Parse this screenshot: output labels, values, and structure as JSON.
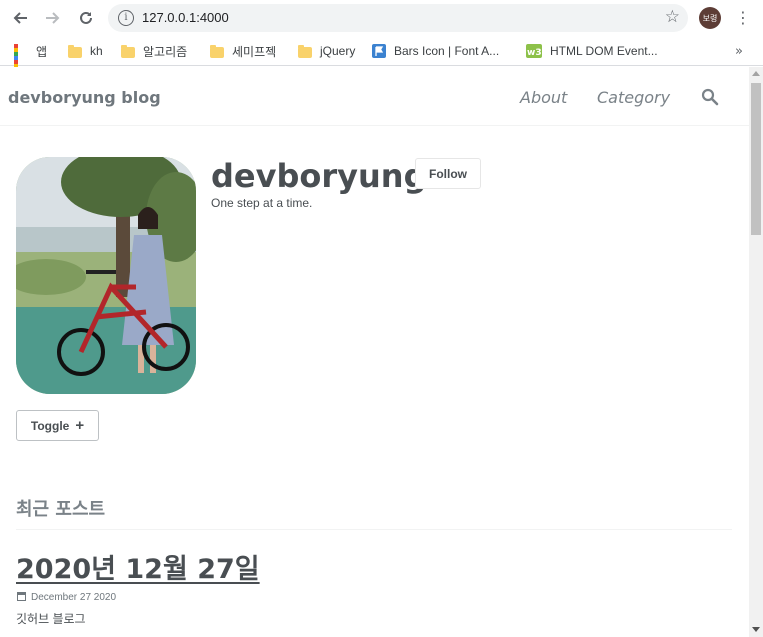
{
  "browser": {
    "url": "127.0.0.1:4000",
    "profile_label": "보령",
    "bookmarks": [
      {
        "label": "앱",
        "icon": "apps-grid-icon"
      },
      {
        "label": "kh",
        "icon": "folder-icon"
      },
      {
        "label": "알고리즘",
        "icon": "folder-icon"
      },
      {
        "label": "세미프젝",
        "icon": "folder-icon"
      },
      {
        "label": "jQuery",
        "icon": "folder-icon"
      },
      {
        "label": "Bars Icon | Font A...",
        "icon": "flag-icon"
      },
      {
        "label": "HTML DOM Event...",
        "icon": "w3-icon"
      }
    ]
  },
  "site": {
    "title": "devboryung blog",
    "nav": {
      "about": "About",
      "category": "Category"
    }
  },
  "author": {
    "name": "devboryung",
    "bio": "One step at a time.",
    "follow_label": "Follow",
    "toggle_label": "Toggle"
  },
  "recent": {
    "heading": "최근 포스트",
    "posts": [
      {
        "title": "2020년 12월 27일",
        "date": "December 27 2020",
        "excerpt": "깃허브 블로그"
      }
    ]
  },
  "colors": {
    "text": "#494e52",
    "muted": "#7a8288",
    "profile": "#5d3d36"
  }
}
